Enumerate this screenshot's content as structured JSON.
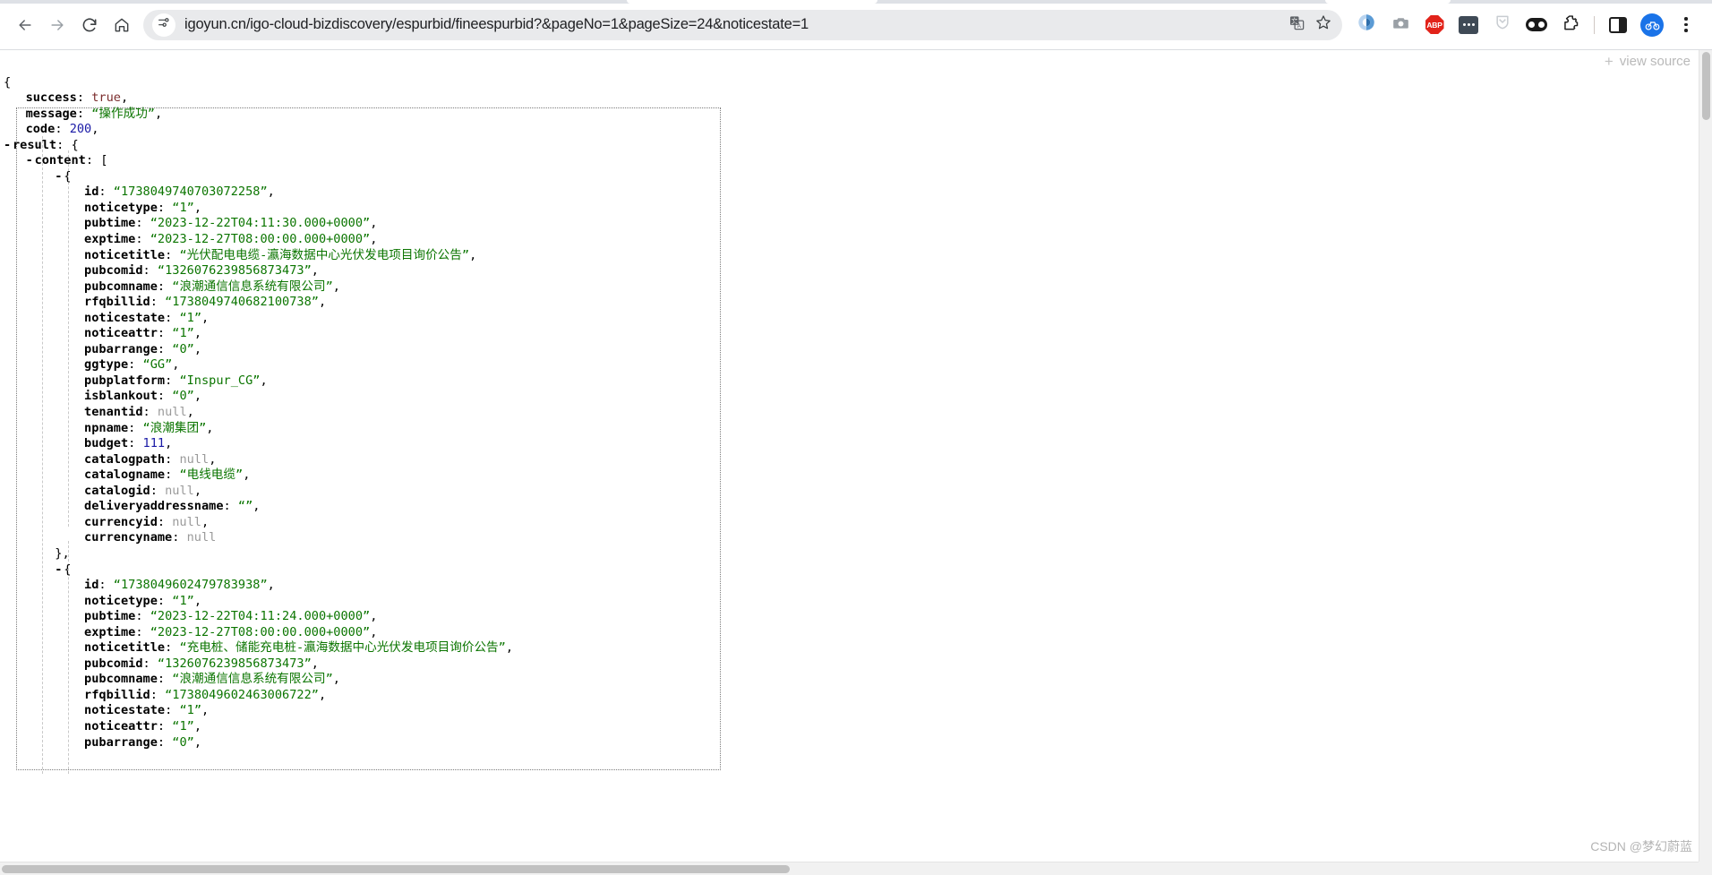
{
  "browser": {
    "back_label": "back-arrow",
    "forward_label": "forward-arrow",
    "reload_label": "reload",
    "home_label": "home",
    "url": "igoyun.cn/igo-cloud-bizdiscovery/espurbid/fineespurbid?&pageNo=1&pageSize=24&noticestate=1",
    "site_info_icon": "tune-icon",
    "translate_icon": "translate-icon",
    "bookmark_icon": "star-icon",
    "extensions": [
      {
        "name": "lens-circle-icon",
        "label": ""
      },
      {
        "name": "screenshot-camera-icon",
        "label": ""
      },
      {
        "name": "adblock-plus-icon",
        "label": "ABP"
      },
      {
        "name": "password-manager-icon",
        "label": ""
      },
      {
        "name": "shield-outline-icon",
        "label": ""
      },
      {
        "name": "pocket-pill-icon",
        "label": ""
      },
      {
        "name": "extensions-puzzle-icon",
        "label": ""
      },
      {
        "name": "side-panel-icon",
        "label": ""
      },
      {
        "name": "profile-avatar-icon",
        "label": ""
      },
      {
        "name": "chrome-menu-icon",
        "label": ""
      }
    ]
  },
  "viewer": {
    "view_source_label": "view source",
    "expand_toggle": "+",
    "watermark": "CSDN @梦幻蔚蓝"
  },
  "json": {
    "success": "true",
    "message": "操作成功",
    "code": "200",
    "records": [
      {
        "id": "1738049740703072258",
        "noticetype": "1",
        "pubtime": "2023-12-22T04:11:30.000+0000",
        "exptime": "2023-12-27T08:00:00.000+0000",
        "noticetitle": "光伏配电电缆-瀛海数据中心光伏发电项目询价公告",
        "pubcomid": "1326076239856873473",
        "pubcomname": "浪潮通信信息系统有限公司",
        "rfqbillid": "1738049740682100738",
        "noticestate": "1",
        "noticeattr": "1",
        "pubarrange": "0",
        "ggtype": "GG",
        "pubplatform": "Inspur_CG",
        "isblankout": "0",
        "tenantid": "null",
        "npname": "浪潮集团",
        "budget": "111",
        "catalogpath": "null",
        "catalogname": "电线电缆",
        "catalogid": "null",
        "deliveryaddressname": "",
        "currencyid": "null",
        "currencyname": "null"
      },
      {
        "id": "1738049602479783938",
        "noticetype": "1",
        "pubtime": "2023-12-22T04:11:24.000+0000",
        "exptime": "2023-12-27T08:00:00.000+0000",
        "noticetitle": "充电桩、储能充电桩-瀛海数据中心光伏发电项目询价公告",
        "pubcomid": "1326076239856873473",
        "pubcomname": "浪潮通信信息系统有限公司",
        "rfqbillid": "1738049602463006722",
        "noticestate": "1",
        "noticeattr": "1",
        "pubarrange": "0"
      }
    ],
    "labels": {
      "success": "success",
      "message": "message",
      "code": "code",
      "result": "result",
      "content": "content",
      "id": "id",
      "noticetype": "noticetype",
      "pubtime": "pubtime",
      "exptime": "exptime",
      "noticetitle": "noticetitle",
      "pubcomid": "pubcomid",
      "pubcomname": "pubcomname",
      "rfqbillid": "rfqbillid",
      "noticestate": "noticestate",
      "noticeattr": "noticeattr",
      "pubarrange": "pubarrange",
      "ggtype": "ggtype",
      "pubplatform": "pubplatform",
      "isblankout": "isblankout",
      "tenantid": "tenantid",
      "npname": "npname",
      "budget": "budget",
      "catalogpath": "catalogpath",
      "catalogname": "catalogname",
      "catalogid": "catalogid",
      "deliveryaddressname": "deliveryaddressname",
      "currencyid": "currencyid",
      "currencyname": "currencyname"
    }
  }
}
